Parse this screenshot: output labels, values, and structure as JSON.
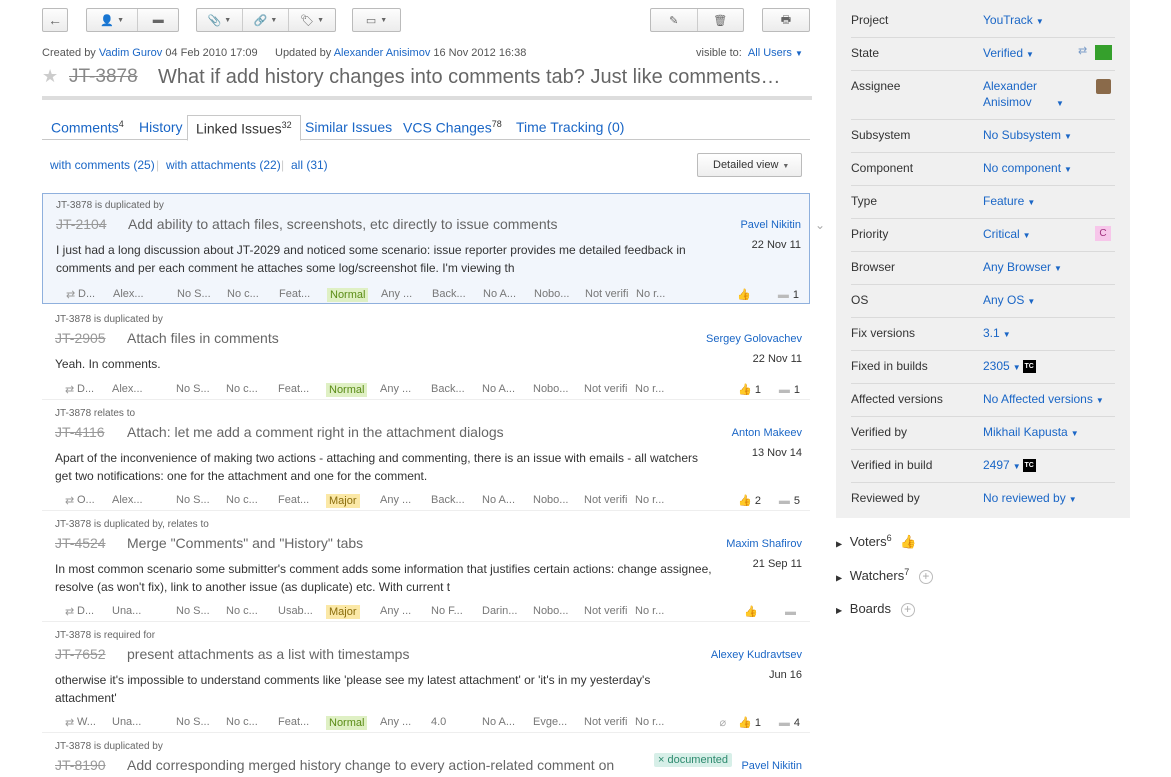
{
  "toolbar": {
    "visible_label": "visible to:",
    "visible_value": "All Users"
  },
  "meta": {
    "created_prefix": "Created by",
    "creator": "Vadim Gurov",
    "created_date": "04 Feb 2010 17:09",
    "updated_prefix": "Updated by",
    "updater": "Alexander Anisimov",
    "updated_date": "16 Nov 2012 16:38"
  },
  "issue": {
    "id": "JT-3878",
    "title": "What if add history changes into comments tab? Just like comments…"
  },
  "tabs": [
    {
      "label": "Comments",
      "count": "4"
    },
    {
      "label": "History",
      "count": ""
    },
    {
      "label": "Linked Issues",
      "count": "32"
    },
    {
      "label": "Similar Issues",
      "count": ""
    },
    {
      "label": "VCS Changes",
      "count": "78"
    },
    {
      "label": "Time Tracking (0)",
      "count": ""
    }
  ],
  "filters": [
    "with comments (25)",
    "with attachments (22)",
    "all (31)"
  ],
  "detailed_view": "Detailed view",
  "linked": [
    {
      "rel": "JT-3878 is duplicated by",
      "id": "JT-2104",
      "title": "Add ability to attach files, screenshots, etc directly to issue comments",
      "author": "Pavel Nikitin",
      "date": "22 Nov 11",
      "body": "I just had a long discussion about JT-2029 and noticed some scenario: issue reporter provides me detailed feedback in comments and per each comment he attaches some log/screenshot file. I'm viewing th",
      "f": [
        "D...",
        "Alex...",
        "No S...",
        "No c...",
        "Feat...",
        "Normal",
        "Any ...",
        "Back...",
        "No A...",
        "Nobo...",
        "Not verifi",
        "No r..."
      ],
      "votes": "",
      "comments": "1"
    },
    {
      "rel": "JT-3878 is duplicated by",
      "id": "JT-2905",
      "title": "Attach files in comments",
      "author": "Sergey Golovachev",
      "date": "22 Nov 11",
      "body": "Yeah. In comments.",
      "f": [
        "D...",
        "Alex...",
        "No S...",
        "No c...",
        "Feat...",
        "Normal",
        "Any ...",
        "Back...",
        "No A...",
        "Nobo...",
        "Not verifi",
        "No r..."
      ],
      "votes": "1",
      "comments": "1"
    },
    {
      "rel": "JT-3878 relates to",
      "id": "JT-4116",
      "title": "Attach: let me add a comment right in the attachment dialogs",
      "author": "Anton Makeev",
      "date": "13 Nov 14",
      "body": "Apart of the inconvenience of making two actions - attaching and commenting, there is an issue with emails - all watchers get two notifications: one for the attachment and one for the comment.",
      "f": [
        "O...",
        "Alex...",
        "No S...",
        "No c...",
        "Feat...",
        "Major",
        "Any ...",
        "Back...",
        "No A...",
        "Nobo...",
        "Not verifi",
        "No r..."
      ],
      "votes": "2",
      "comments": "5"
    },
    {
      "rel": "JT-3878 is duplicated by, relates to",
      "id": "JT-4524",
      "title": "Merge \"Comments\" and \"History\" tabs",
      "author": "Maxim Shafirov",
      "date": "21 Sep 11",
      "body": "In most common scenario some submitter's comment adds some information that justifies certain actions: change assignee, resolve (as won't fix), link to another issue (as duplicate) etc. With current t",
      "f": [
        "D...",
        "Una...",
        "No S...",
        "No c...",
        "Usab...",
        "Major",
        "Any ...",
        "No F...",
        "Darin...",
        "Nobo...",
        "Not verifi",
        "No r..."
      ],
      "votes": "",
      "comments": ""
    },
    {
      "rel": "JT-3878 is required for",
      "id": "JT-7652",
      "title": "present attachments as a list with timestamps",
      "author": "Alexey Kudravtsev",
      "date": "Jun 16",
      "body": "otherwise it's impossible to understand comments like 'please see my latest attachment' or 'it's in my yesterday's attachment'",
      "f": [
        "W...",
        "Una...",
        "No S...",
        "No c...",
        "Feat...",
        "Normal",
        "Any ...",
        "4.0",
        "No A...",
        "Evge...",
        "Not verifi",
        "No r..."
      ],
      "votes": "1",
      "comments": "4"
    },
    {
      "rel": "JT-3878 is duplicated by",
      "id": "JT-8190",
      "title": "Add corresponding merged history change to every action-related comment on",
      "author": "Pavel Nikitin",
      "tag": "documented"
    }
  ],
  "sidebar": [
    {
      "label": "Project",
      "value": "YouTrack"
    },
    {
      "label": "State",
      "value": "Verified"
    },
    {
      "label": "Assignee",
      "value": "Alexander Anisimov"
    },
    {
      "label": "Subsystem",
      "value": "No Subsystem"
    },
    {
      "label": "Component",
      "value": "No component"
    },
    {
      "label": "Type",
      "value": "Feature"
    },
    {
      "label": "Priority",
      "value": "Critical",
      "badge": "C"
    },
    {
      "label": "Browser",
      "value": "Any Browser"
    },
    {
      "label": "OS",
      "value": "Any OS"
    },
    {
      "label": "Fix versions",
      "value": "3.1"
    },
    {
      "label": "Fixed in builds",
      "value": "2305"
    },
    {
      "label": "Affected versions",
      "value": "No Affected versions"
    },
    {
      "label": "Verified by",
      "value": "Mikhail Kapusta"
    },
    {
      "label": "Verified in build",
      "value": "2497"
    },
    {
      "label": "Reviewed by",
      "value": "No reviewed by"
    }
  ],
  "tc_badge": "TC",
  "voters": {
    "label": "Voters",
    "count": "6"
  },
  "watchers": {
    "label": "Watchers",
    "count": "7"
  },
  "boards": {
    "label": "Boards"
  },
  "colors": {
    "accent": "#1a66c6",
    "state_green": "#35a02c",
    "priority_badge": "#f7c6ea"
  }
}
